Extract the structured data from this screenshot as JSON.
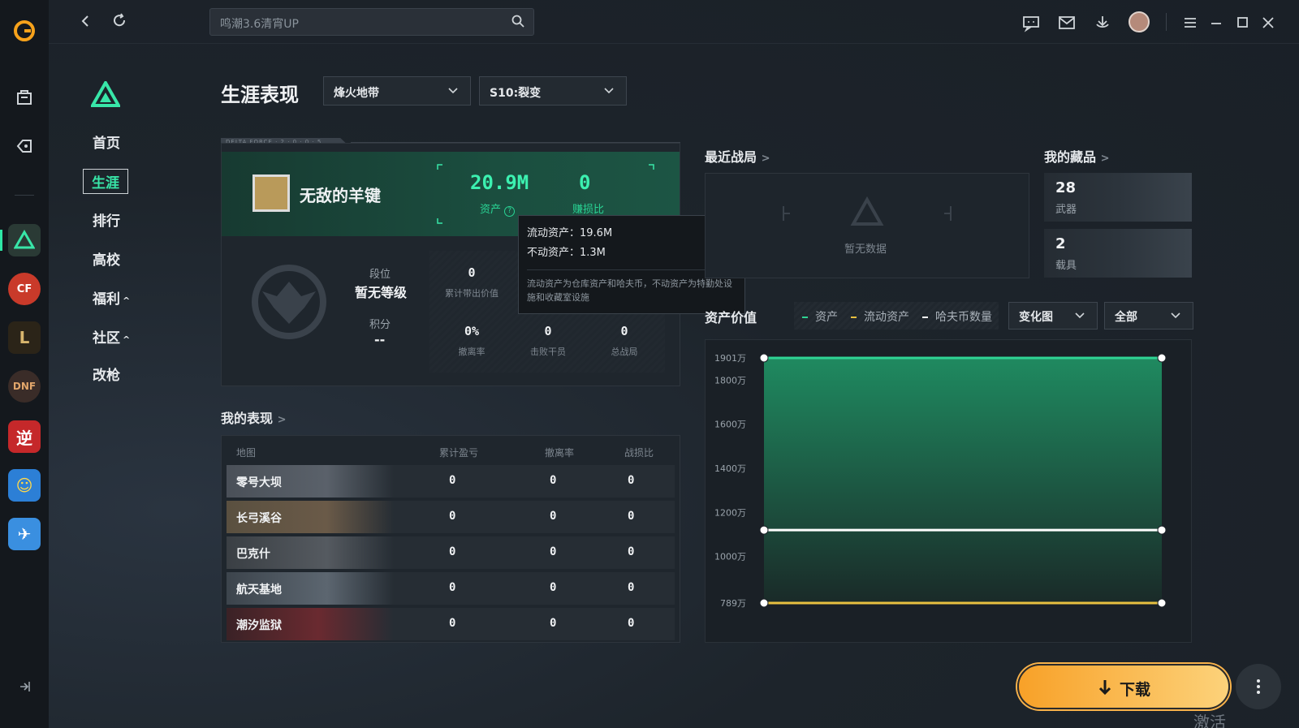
{
  "search": {
    "placeholder": "鸣潮3.6清宵UP"
  },
  "subnav": {
    "items": [
      "首页",
      "生涯",
      "排行",
      "高校",
      "福利",
      "社区",
      "改枪"
    ]
  },
  "header": {
    "title": "生涯表现",
    "mode_select": "烽火地带",
    "season_select": "S10:裂变"
  },
  "profile": {
    "card_tag": "DELTA FORCE · 2 · 0 · 0 · 5",
    "name": "无敌的羊键",
    "assets_value": "20.9M",
    "assets_label": "资产",
    "kd_value": "0",
    "kd_label": "赚损比",
    "rank_label": "段位",
    "rank_value": "暂无等级",
    "points_label": "积分",
    "points_value": "--",
    "stats": [
      {
        "value": "0",
        "label": "累计带出价值"
      },
      {
        "value": "0%",
        "label": "撤离率"
      },
      {
        "value": "0",
        "label": "击败干员"
      },
      {
        "value": "0",
        "label": "总战局"
      }
    ]
  },
  "tooltip": {
    "liquid": "流动资产：19.6M",
    "fixed": "不动资产：1.3M",
    "note": "流动资产为仓库资产和哈夫币，不动资产为特勤处设施和收藏室设施"
  },
  "performance": {
    "title": "我的表现",
    "headers": [
      "地图",
      "累计盈亏",
      "撤离率",
      "战损比"
    ],
    "rows": [
      {
        "map": "零号大坝",
        "profit": "0",
        "evac": "0",
        "kd": "0"
      },
      {
        "map": "长弓溪谷",
        "profit": "0",
        "evac": "0",
        "kd": "0"
      },
      {
        "map": "巴克什",
        "profit": "0",
        "evac": "0",
        "kd": "0"
      },
      {
        "map": "航天基地",
        "profit": "0",
        "evac": "0",
        "kd": "0"
      },
      {
        "map": "潮汐监狱",
        "profit": "0",
        "evac": "0",
        "kd": "0"
      }
    ]
  },
  "recent": {
    "title": "最近战局",
    "empty": "暂无数据"
  },
  "collection": {
    "title": "我的藏品",
    "items": [
      {
        "count": "28",
        "label": "武器"
      },
      {
        "count": "2",
        "label": "载具"
      }
    ]
  },
  "asset_chart": {
    "title": "资产价值",
    "legend": [
      "资产",
      "流动资产",
      "哈夫币数量"
    ],
    "view_select": "变化图",
    "range_select": "全部"
  },
  "chart_data": {
    "type": "area",
    "ylabel_ticks": [
      "1901万",
      "1800万",
      "1600万",
      "1400万",
      "1200万",
      "1000万",
      "789万"
    ],
    "ylim": [
      789,
      1901
    ],
    "x": [
      "t1",
      "t2"
    ],
    "series": [
      {
        "name": "资产",
        "values": [
          1901,
          1901
        ],
        "color": "#2fd494"
      },
      {
        "name": "流动资产",
        "values": [
          1120,
          1120
        ],
        "color": "#ffffff"
      },
      {
        "name": "哈夫币数量",
        "values": [
          789,
          789
        ],
        "color": "#e8c040"
      }
    ]
  },
  "download": {
    "label": "下载"
  },
  "watermark": "激活 Windows",
  "colors": {
    "accent": "#38e6a8",
    "download": "#f8a128"
  }
}
